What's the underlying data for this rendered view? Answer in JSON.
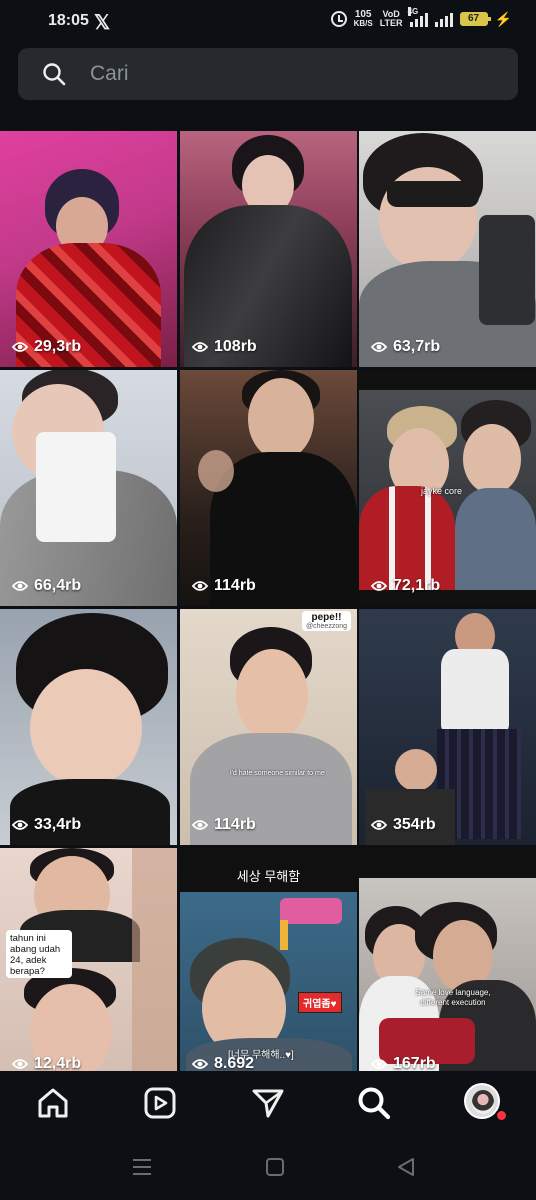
{
  "status_bar": {
    "time": "18:05",
    "netspeed_value": "105",
    "netspeed_unit": "KB/S",
    "volte_top": "VoD",
    "volte_bottom": "LTER",
    "network": "4G",
    "battery": "67"
  },
  "search": {
    "placeholder": "Cari"
  },
  "grid": {
    "tiles": [
      {
        "views": "29,3rb"
      },
      {
        "views": "108rb"
      },
      {
        "views": "63,7rb"
      },
      {
        "views": "66,4rb"
      },
      {
        "views": "114rb"
      },
      {
        "views": "72,1rb",
        "caption": "jayke core"
      },
      {
        "views": "33,4rb"
      },
      {
        "views": "114rb",
        "username": "pepe!!",
        "handle": "@cheezzong",
        "caption": "i'd hate someone similar to me"
      },
      {
        "views": "354rb"
      },
      {
        "views": "12,4rb",
        "caption": "tahun ini abang udah 24, adek berapa?"
      },
      {
        "views": "8.692",
        "title": "세상 무해함",
        "badge": "귀엽좀♥",
        "subtitle": "[너무 무해해..♥]"
      },
      {
        "views": "167rb",
        "caption": "Same love language, different execution"
      }
    ]
  },
  "bottom_nav": {
    "items": [
      "home-icon",
      "reels-icon",
      "direct-icon",
      "search-icon",
      "profile-avatar"
    ],
    "active": "search-icon"
  },
  "colors": {
    "background": "#0c1014",
    "search_bg": "#262a2e",
    "placeholder": "#8c9196",
    "notification": "#ff3040"
  }
}
